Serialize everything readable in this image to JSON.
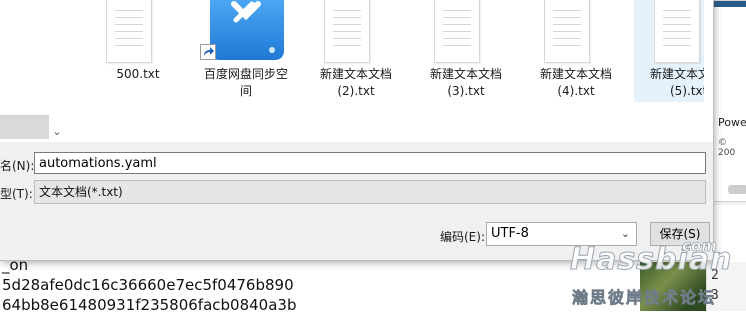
{
  "background": {
    "lines": [
      "_on",
      " 5d28afe0dc16c36660e7ec5f0476b890",
      "64bb8e61480931f235806facb0840a3b"
    ]
  },
  "files": [
    {
      "name_line1": "500.txt",
      "name_line2": ""
    },
    {
      "name_line1": "百度网盘同步空",
      "name_line2": "间"
    },
    {
      "name_line1": "新建文本文档",
      "name_line2": "(2).txt"
    },
    {
      "name_line1": "新建文本文档",
      "name_line2": "(3).txt"
    },
    {
      "name_line1": "新建文本文档",
      "name_line2": "(4).txt"
    },
    {
      "name_line1": "新建文本文",
      "name_line2": "(5).txt"
    }
  ],
  "form": {
    "filename_label": "名(N):",
    "filename_value": "automations.yaml",
    "filetype_label": "型(T):",
    "filetype_value": "文本文档(*.txt)",
    "encoding_label": "编码(E):",
    "encoding_value": "UTF-8",
    "save_button": "保存(S)"
  },
  "side": {
    "text1": "Powe",
    "text2": "© 200"
  },
  "watermark": {
    "big": "Hassbian",
    "com": "com",
    "small": "瀚思彼岸技术论坛"
  },
  "line_numbers": [
    "2",
    "3"
  ],
  "icons": {
    "scroll": "chevron-down-icon",
    "select": "chevron-down-icon",
    "shortcut": "shortcut-arrow-icon",
    "sync": "baidu-sync-icon"
  }
}
